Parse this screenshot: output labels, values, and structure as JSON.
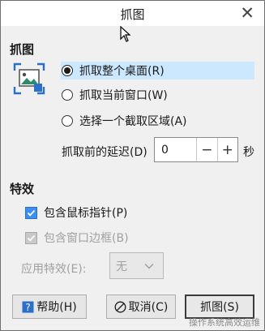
{
  "window": {
    "title": "抓图",
    "close_symbol": "✕"
  },
  "capture": {
    "heading": "抓图",
    "modes": [
      {
        "label": "抓取整个桌面(R)",
        "selected": true
      },
      {
        "label": "抓取当前窗口(W)",
        "selected": false
      },
      {
        "label": "选择一个截取区域(A)",
        "selected": false
      }
    ],
    "delay_label": "抓取前的延迟(D)",
    "delay_value": "0",
    "minus": "−",
    "plus": "+",
    "unit": "秒"
  },
  "effects": {
    "heading": "特效",
    "include_pointer": {
      "label": "包含鼠标指针(P)",
      "checked": true
    },
    "include_border": {
      "label": "包含窗口边框(B)",
      "checked": true,
      "disabled": true
    },
    "apply_effect_label": "应用特效(E):",
    "apply_effect_value": "无"
  },
  "buttons": {
    "help": "帮助(H)",
    "cancel": "取消(C)",
    "capture": "抓图(S)"
  },
  "watermark": "操作系统高效运维",
  "colors": {
    "selection": "#cce8ff",
    "check": "#3c8ff0",
    "icon_accent": "#2a6fc9"
  }
}
